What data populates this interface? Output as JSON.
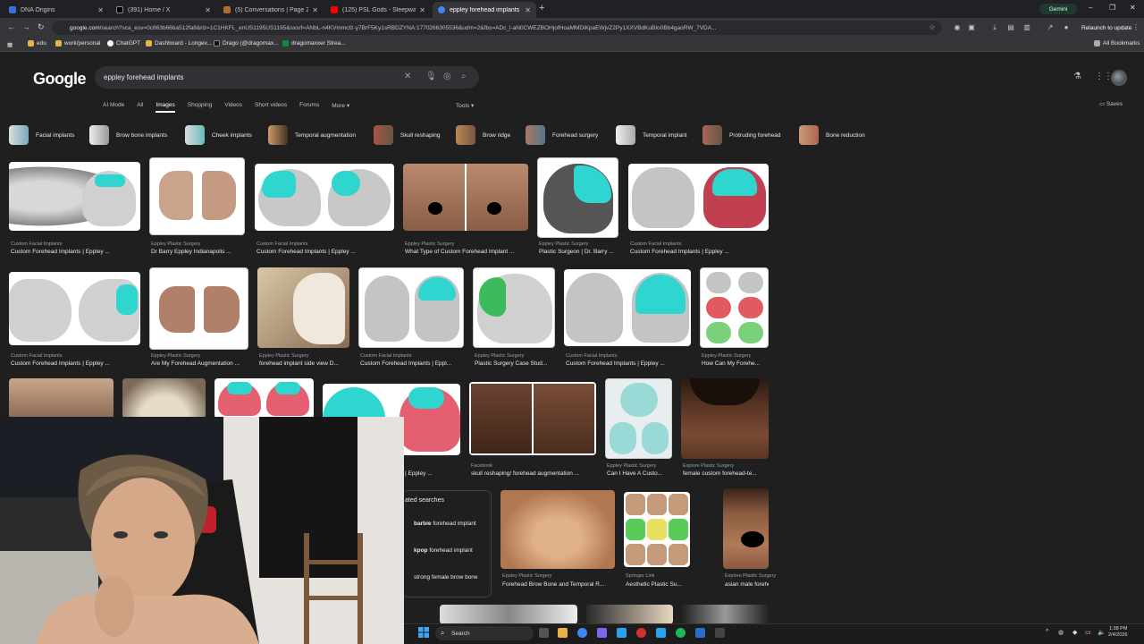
{
  "browser": {
    "tabs": [
      {
        "title": "DNA Origins",
        "color": "#3b6ee0",
        "active": false
      },
      {
        "title": "(391) Home / X",
        "color": "#000000",
        "active": false
      },
      {
        "title": "(5) Conversations | Page 2 | Lo...",
        "color": "#b36b2c",
        "active": false
      },
      {
        "title": "(125) PSL Gods - Sleepwalker",
        "color": "#ff0000",
        "active": false
      },
      {
        "title": "eppley forehead implants - Go...",
        "color": "#4285f4",
        "active": true
      }
    ],
    "gemini_label": "Gemini",
    "address_host": "google.com",
    "address_rest": "/search?sca_esv=0c863b66ba512fa8&rlz=1C1HKFL_enUS1195US1195&sxsrf=ANbL-n4KVmmcfz-y7BrF5Ky1sRBDZYNA:1770266305536&udm=2&fbs=ADc_l-aN0CWEZBOHjofHoaMMDiKpaEWjvZ2Py1XXVBdKuBIo0Bb4gaoRW_7VDA...",
    "relaunch_label": "Relaunch to update",
    "bookmarks": [
      {
        "label": "edu",
        "color": "#e8b448"
      },
      {
        "label": "work/personal",
        "color": "#e8b448"
      },
      {
        "label": "ChatGPT",
        "color": "#ffffff"
      },
      {
        "label": "Dashboard - Longev...",
        "color": "#e8b448"
      },
      {
        "label": "Drago (@dragomax...",
        "color": "#111111"
      },
      {
        "label": "dragomaxxer Strea...",
        "color": "#0c8f3a"
      }
    ],
    "all_bookmarks_label": "All Bookmarks"
  },
  "google": {
    "logo_text": "Google",
    "query": "eppley forehead implants",
    "nav_tabs": [
      "AI Mode",
      "All",
      "Images",
      "Shopping",
      "Videos",
      "Short videos",
      "Forums",
      "More ▾"
    ],
    "active_tab": "Images",
    "tools_label": "Tools ▾",
    "saves_label": "Saves",
    "chips": [
      "Facial implants",
      "Brow bone implants",
      "Cheek implants",
      "Temporal augmentation",
      "Skull reshaping",
      "Brow ridge",
      "Forehead surgery",
      "Temporal implant",
      "Protruding forehead",
      "Bone reduction"
    ],
    "results": [
      {
        "source": "Custom Facial Implants",
        "caption": "Custom Forehead Implants | Eppley ..."
      },
      {
        "source": "Eppley Plastic Surgery",
        "caption": "Dr Barry Eppley Indianapolis ..."
      },
      {
        "source": "Custom Facial Implants",
        "caption": "Custom Forehead Implants | Eppley ..."
      },
      {
        "source": "Eppley Plastic Surgery",
        "caption": "What Type of Custom Forehead Implant ..."
      },
      {
        "source": "Eppley Plastic Surgery",
        "caption": "Plastic Surgeon | Dr. Barry ..."
      },
      {
        "source": "Custom Facial Implants",
        "caption": "Custom Forehead Implants | Eppley ..."
      },
      {
        "source": "Custom Facial Implants",
        "caption": "Custom Forehead Implants | Eppley ..."
      },
      {
        "source": "Eppley Plastic Surgery",
        "caption": "Are My Forehead Augmentation ..."
      },
      {
        "source": "Eppley Plastic Surgery",
        "caption": "forehead implant side view D..."
      },
      {
        "source": "Custom Facial Implants",
        "caption": "Custom Forehead Implants | Eppl..."
      },
      {
        "source": "Eppley Plastic Surgery",
        "caption": "Plastic Surgery Case Stud..."
      },
      {
        "source": "Custom Facial Implants",
        "caption": "Custom Forehead Implants | Eppley ..."
      },
      {
        "source": "Eppley Plastic Surgery",
        "caption": "How Can My Forehe..."
      },
      {
        "source": "",
        "caption": "| Eppley ..."
      },
      {
        "source": "Facebook",
        "caption": "skull reshaping/ forehead augmentation ..."
      },
      {
        "source": "Eppley Plastic Surgery",
        "caption": "Can I Have A Custo..."
      },
      {
        "source": "Explore Plastic Surgery",
        "caption": "female custom forehead-te..."
      },
      {
        "source": "Eppley Plastic Surgery",
        "caption": "Forehead Brow Bone and Temporal R..."
      },
      {
        "source": "Springer Link",
        "caption": "Aesthetic Plastic Su..."
      },
      {
        "source": "Explore Plastic Surgery",
        "caption": "asian male forehead ..."
      }
    ],
    "related": {
      "title": "ated searches",
      "items": [
        {
          "bold": "barbie",
          "rest": " forehead implant"
        },
        {
          "bold": "kpop",
          "rest": " forehead implant"
        },
        {
          "bold": "",
          "rest": "strong female brow bone"
        }
      ]
    }
  },
  "taskbar": {
    "search_label": "Search",
    "time": "1:38 PM",
    "date": "2/4/2026"
  }
}
